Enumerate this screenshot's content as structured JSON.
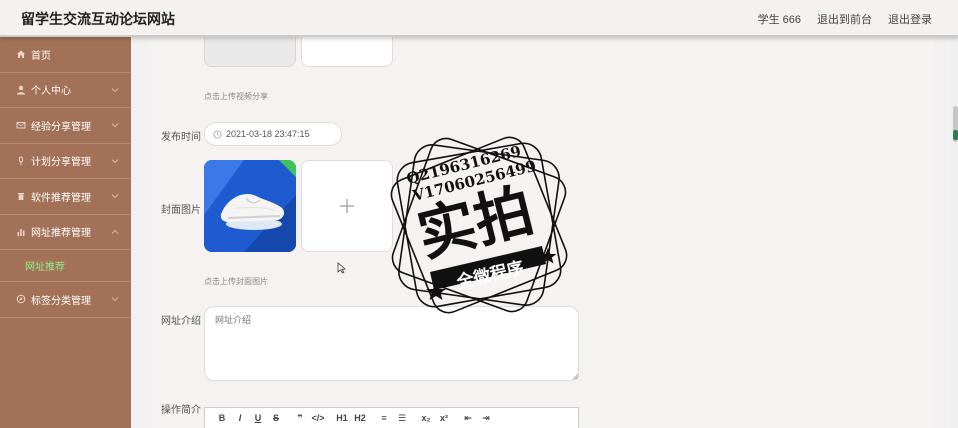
{
  "header": {
    "site_title": "留学生交流互动论坛网站",
    "user_label": "学生 666",
    "back_front": "退出到前台",
    "logout": "退出登录"
  },
  "sidebar": {
    "items": [
      {
        "label": "首页",
        "icon": "home-icon"
      },
      {
        "label": "个人中心",
        "icon": "user-icon"
      },
      {
        "label": "经验分享管理",
        "icon": "mail-icon"
      },
      {
        "label": "计划分享管理",
        "icon": "pin-icon"
      },
      {
        "label": "软件推荐管理",
        "icon": "trash-icon"
      },
      {
        "label": "网址推荐管理",
        "icon": "chart-icon"
      },
      {
        "label": "标签分类管理",
        "icon": "compass-icon"
      }
    ],
    "active_sub": "网址推荐"
  },
  "form": {
    "video_tip": "点击上传视频分享",
    "publish_time_label": "发布时间",
    "publish_time_value": "2021-03-18 23:47:15",
    "cover_label": "封面图片",
    "cover_tip": "点击上传封面图片",
    "url_intro_label": "网址介绍",
    "url_intro_placeholder": "网址介绍",
    "op_intro_label": "操作简介"
  },
  "editor_toolbar": [
    "B",
    "I",
    "U",
    "S",
    "❞",
    "</>",
    "H1",
    "H2",
    "≡",
    "☰",
    "x₂",
    "x²",
    "⇤",
    "⇥"
  ],
  "watermark": {
    "line1": "Q2196316269",
    "line2": "V17060256499",
    "big_text": "实拍",
    "ribbon_text": "全微程序"
  },
  "colors": {
    "sidebar_bg": "#a37158",
    "active_sub": "#8ff08a",
    "header_bg": "#f4f1f1"
  }
}
